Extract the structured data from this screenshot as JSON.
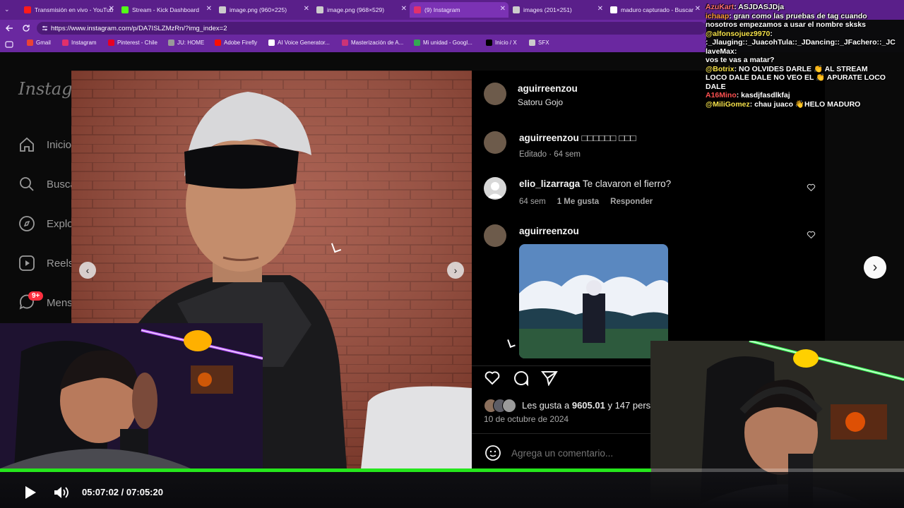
{
  "browser": {
    "tabs": [
      {
        "title": "Transmisión en vivo - YouTub",
        "fav": "#ff1a1a",
        "active": false
      },
      {
        "title": "Stream - Kick Dashboard",
        "fav": "#53fc18",
        "active": false
      },
      {
        "title": "image.png (960×225)",
        "fav": "#cccccc",
        "active": false
      },
      {
        "title": "image.png (968×529)",
        "fav": "#cccccc",
        "active": false
      },
      {
        "title": "(9) Instagram",
        "fav": "#e1306c",
        "active": true
      },
      {
        "title": "images (201×251)",
        "fav": "#cccccc",
        "active": false
      },
      {
        "title": "maduro capturado - Buscar",
        "fav": "#ffffff",
        "active": false
      }
    ],
    "url": "https://www.instagram.com/p/DA7ISLZMzRn/?img_index=2",
    "bookmarks": [
      {
        "label": "Gmail",
        "color": "#ea4335"
      },
      {
        "label": "Instagram",
        "color": "#e1306c"
      },
      {
        "label": "Pinterest - Chile",
        "color": "#e60023"
      },
      {
        "label": "JU: HOME",
        "color": "#999999"
      },
      {
        "label": "Adobe Firefly",
        "color": "#fa0f00"
      },
      {
        "label": "AI Voice Generator...",
        "color": "#ffffff"
      },
      {
        "label": "Masterización de A...",
        "color": "#cc3377"
      },
      {
        "label": "Mi unidad - Googl...",
        "color": "#34a853"
      },
      {
        "label": "Inicio / X",
        "color": "#000000"
      },
      {
        "label": "SFX",
        "color": "#cccccc"
      }
    ]
  },
  "instagram": {
    "logo": "Instagr",
    "nav": [
      "Inicio",
      "Busca",
      "Explo",
      "Reels",
      "Mens"
    ],
    "nav_badge": "9+",
    "post": {
      "author": "aguirreenzou",
      "location": "Satoru Gojo",
      "caption_user": "aguirreenzou",
      "caption_text": "□□□□□□ □□□",
      "caption_meta": "Editado · 64 sem",
      "comments": [
        {
          "user": "elio_lizarraga",
          "text": "Te clavaron el fierro?",
          "time": "64 sem",
          "likes": "1 Me gusta",
          "reply": "Responder"
        },
        {
          "user": "aguirreenzou",
          "text": "",
          "time": "",
          "likes": "",
          "reply": ""
        }
      ],
      "likes_text": "Les gusta a",
      "likes_count": "9605.01",
      "likes_rest": "y 147 pers",
      "date": "10 de octubre de 2024",
      "comment_placeholder": "Agrega un comentario..."
    }
  },
  "chat": {
    "lines": [
      {
        "user": "AzuKart",
        "user_color": "#ff7070",
        "text": ": ASJDASJDja"
      },
      {
        "user": "ichaap",
        "user_color": "#ff9a3c",
        "text": ": gran como las pruebas de tag cuando"
      },
      {
        "user": "",
        "user_color": "#ffffff",
        "text": "nosotros empezamos a usar el nombre sksks"
      },
      {
        "user": "@alfonsojuez9970",
        "user_color": "#f5e14a",
        "text": ":"
      },
      {
        "user": "",
        "user_color": "#ffffff",
        "text": ":_Jlauging::_JuacohTula::_JDancing::_JFachero::_JC"
      },
      {
        "user": "laveMax",
        "user_color": "#ffffff",
        "text": ":"
      },
      {
        "user": "",
        "user_color": "#ffffff",
        "text": "vos te vas a matar?"
      },
      {
        "user": "@Botrix",
        "user_color": "#f5e14a",
        "text": ": NO OLVIDES DARLE 👏 AL STREAM"
      },
      {
        "user": "",
        "user_color": "#ffffff",
        "text": "LOCO DALE DALE NO VEO EL 👏 APURATE LOCO"
      },
      {
        "user": "DALE",
        "user_color": "#ffffff",
        "text": ""
      },
      {
        "user": "A16Mino",
        "user_color": "#ff5050",
        "text": ": kasdjfasdlkfaj"
      },
      {
        "user": "@MiliGomez",
        "user_color": "#f5e14a",
        "text": ": chau juaco 👋HELO MADURO"
      }
    ]
  },
  "player": {
    "time_current": "05:07:02",
    "time_sep": "/",
    "time_total": "07:05:20",
    "progress_pct": 72
  },
  "colors": {
    "accent": "#25e61c",
    "chrome": "#6a28a0"
  },
  "icons": [
    "back-arrow-icon",
    "reload-icon",
    "heart-icon",
    "comment-icon",
    "share-icon",
    "emoji-icon",
    "play-icon",
    "volume-icon",
    "chevron-left-icon",
    "chevron-right-icon"
  ]
}
